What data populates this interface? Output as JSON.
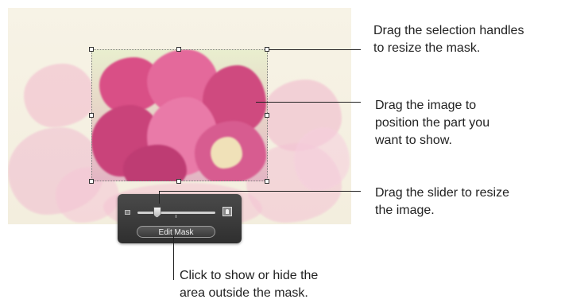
{
  "editor": {
    "edit_mask_button": "Edit Mask"
  },
  "callouts": {
    "handles": [
      "Drag the selection handles",
      "to resize the mask."
    ],
    "image": [
      "Drag the image to",
      "position the part you",
      "want to show."
    ],
    "slider": [
      "Drag the slider to resize",
      "the image."
    ],
    "button": [
      "Click to show or hide the",
      "area outside the mask."
    ]
  },
  "slider": {
    "value": 0.25
  },
  "colors": {
    "hud": "#3a3a3a",
    "petal_pink": "#e06a9a",
    "background": "#f5f1e2"
  }
}
